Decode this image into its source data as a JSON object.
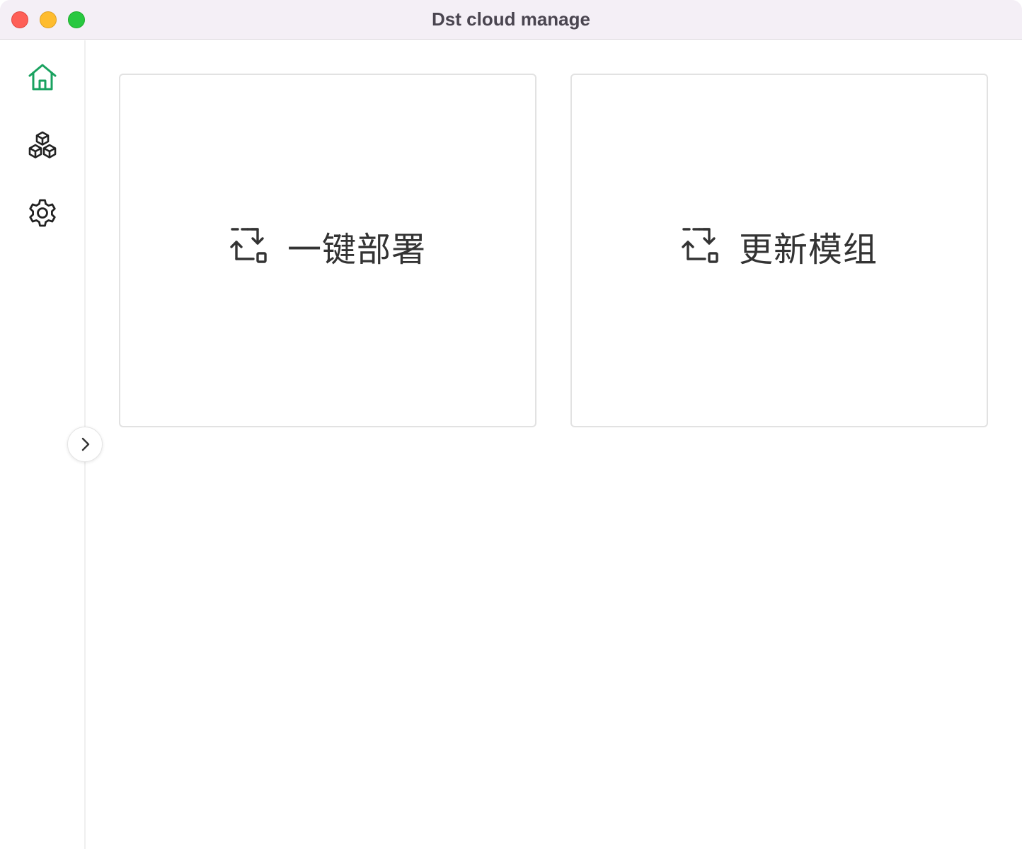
{
  "window": {
    "title": "Dst cloud manage"
  },
  "colors": {
    "accent": "#1aa260",
    "titlebar_bg": "#f4eff6",
    "icon_dark": "#333333"
  },
  "sidebar": {
    "items": [
      {
        "icon": "home-icon",
        "active": true
      },
      {
        "icon": "cubes-icon",
        "active": false
      },
      {
        "icon": "gear-icon",
        "active": false
      }
    ],
    "collapse_icon": "chevron-right-icon"
  },
  "main": {
    "cards": [
      {
        "icon": "transfer-icon",
        "label": "一键部署"
      },
      {
        "icon": "transfer-icon",
        "label": "更新模组"
      }
    ]
  }
}
